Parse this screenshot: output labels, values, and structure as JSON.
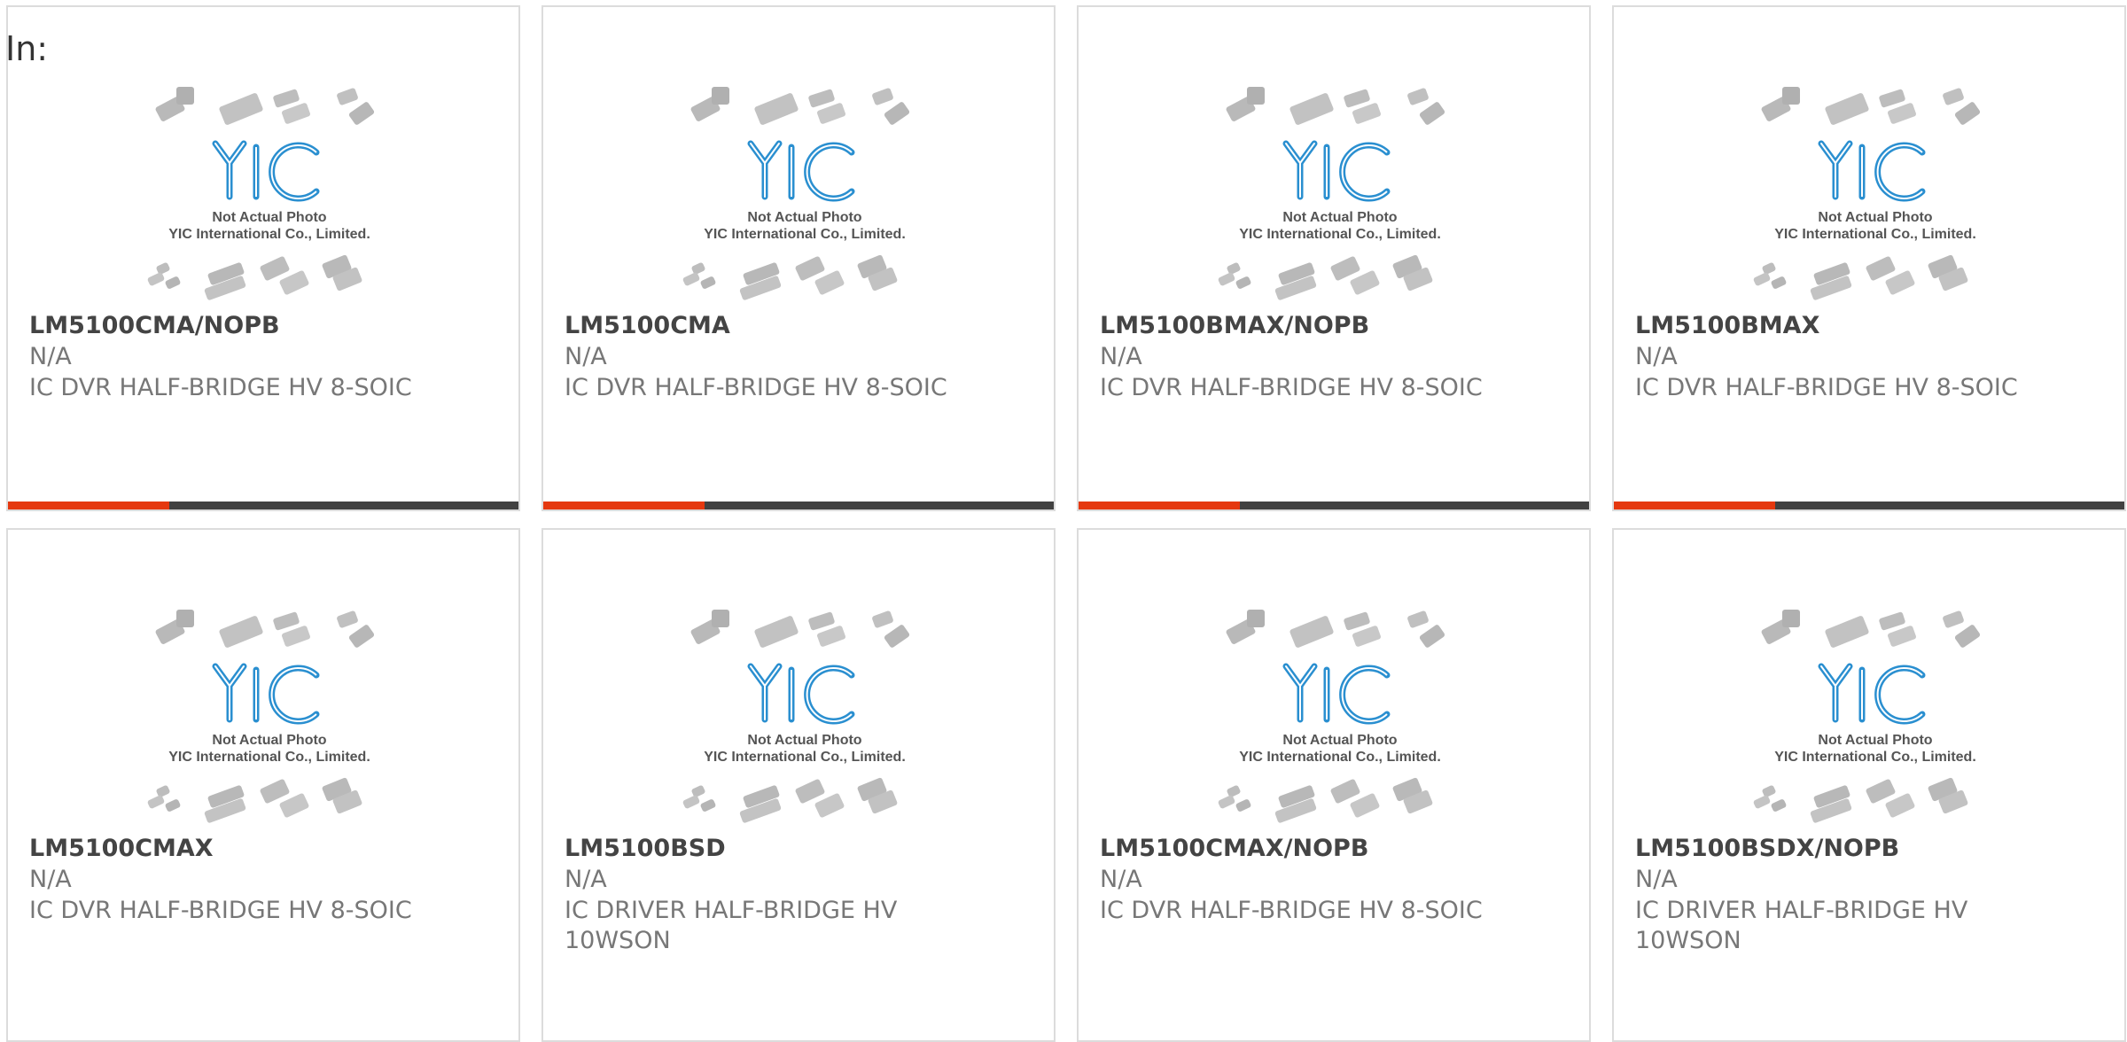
{
  "filter_label": "In:",
  "colors": {
    "accent": "#e5380f",
    "bar": "#414141",
    "card_border": "#dcdcdc"
  },
  "placeholder_image": {
    "icon": "yic-not-actual-photo-icon",
    "line1": "Not Actual Photo",
    "line2": "YIC International Co., Limited."
  },
  "products": [
    {
      "part_number": "LM5100CMA/NOPB",
      "manufacturer": "N/A",
      "description": "IC DVR HALF-BRIDGE HV 8-SOIC"
    },
    {
      "part_number": "LM5100CMA",
      "manufacturer": "N/A",
      "description": "IC DVR HALF-BRIDGE HV 8-SOIC"
    },
    {
      "part_number": "LM5100BMAX/NOPB",
      "manufacturer": "N/A",
      "description": "IC DVR HALF-BRIDGE HV 8-SOIC"
    },
    {
      "part_number": "LM5100BMAX",
      "manufacturer": "N/A",
      "description": "IC DVR HALF-BRIDGE HV 8-SOIC"
    },
    {
      "part_number": "LM5100CMAX",
      "manufacturer": "N/A",
      "description": "IC DVR HALF-BRIDGE HV 8-SOIC"
    },
    {
      "part_number": "LM5100BSD",
      "manufacturer": "N/A",
      "description": "IC DRIVER HALF-BRIDGE HV 10WSON"
    },
    {
      "part_number": "LM5100CMAX/NOPB",
      "manufacturer": "N/A",
      "description": "IC DVR HALF-BRIDGE HV 8-SOIC"
    },
    {
      "part_number": "LM5100BSDX/NOPB",
      "manufacturer": "N/A",
      "description": "IC DRIVER HALF-BRIDGE HV 10WSON"
    }
  ]
}
